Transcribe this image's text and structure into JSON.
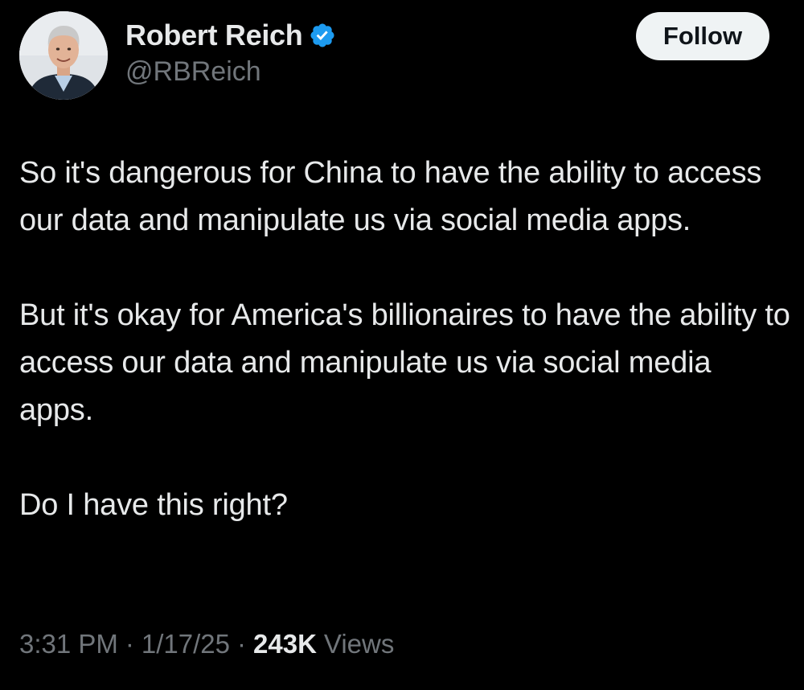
{
  "author": {
    "display_name": "Robert Reich",
    "handle": "@RBReich",
    "verified": true,
    "verified_color": "#1d9bf0"
  },
  "follow_button": {
    "label": "Follow"
  },
  "tweet": {
    "paragraphs": [
      "So it's dangerous for China to have the ability to access our data and manipulate us via social media apps.",
      "But it's okay for America's billionaires to have the ability to access our data and manipulate us via social media apps.",
      "Do I have this right?"
    ]
  },
  "meta": {
    "time": "3:31 PM",
    "separator": "·",
    "date": "1/17/25",
    "views_count": "243K",
    "views_label": "Views"
  },
  "theme": {
    "background": "#000000",
    "text_primary": "#e7e9ea",
    "text_secondary": "#71767b",
    "button_bg": "#eff3f4"
  }
}
